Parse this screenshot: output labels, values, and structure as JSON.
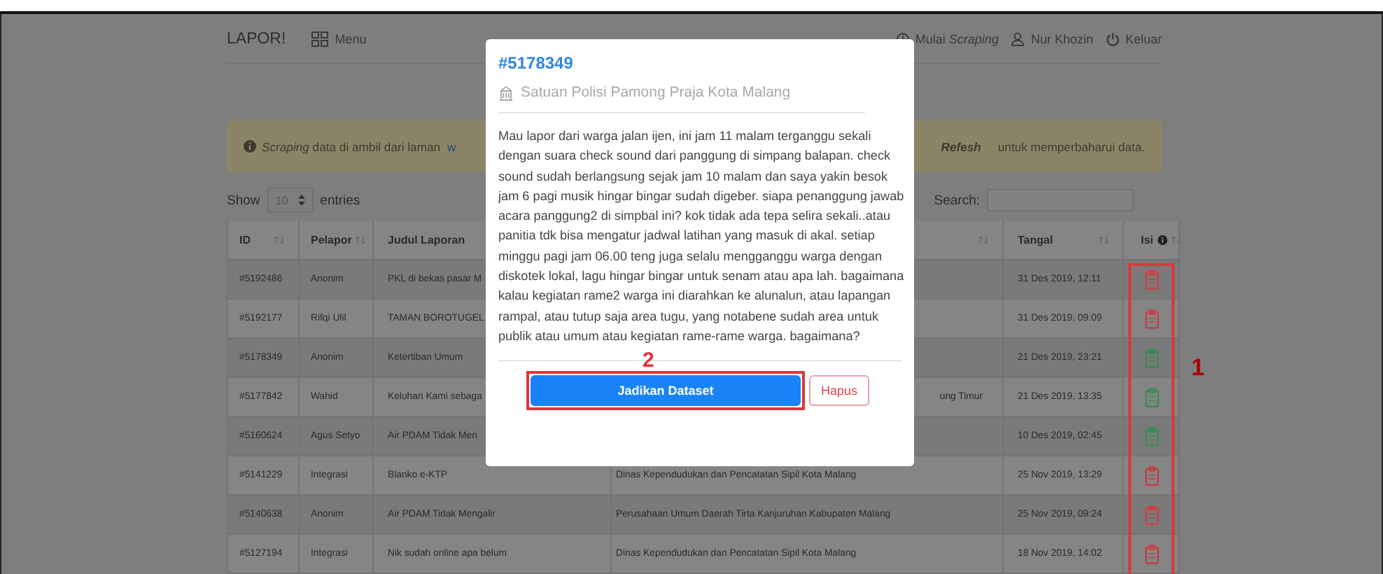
{
  "navbar": {
    "brand": "LAPOR!",
    "menu": "Menu",
    "actions": [
      {
        "label": "Mulai *Scraping*",
        "kind": "scrape"
      },
      {
        "label": "Nur Khozin",
        "kind": "user"
      },
      {
        "label": "Keluar",
        "kind": "logout"
      }
    ]
  },
  "alert": {
    "text": "*Scraping* data di ambil dari laman",
    "link": "w",
    "emphasis": "Refesh",
    "tail": "untuk memperbaharui data."
  },
  "table_controls": {
    "show_label": "Show",
    "page_size": "10",
    "entries_label": "entries",
    "search_label": "Search:"
  },
  "table": {
    "columns": [
      {
        "label": "ID"
      },
      {
        "label": "Pelapor"
      },
      {
        "label": "Judul Laporan"
      },
      {},
      {
        "label": "Tangal"
      },
      {
        "label": "Isi",
        "info": true
      }
    ],
    "rows": [
      {
        "id": "#5192486",
        "pelapor": "Anonim",
        "judul": "PKL di bekas pasar M",
        "tanggal": "31 Des 2019, 12:11",
        "color": "#c2464d"
      },
      {
        "id": "#5192177",
        "pelapor": "Rifqi Ulil",
        "judul": "TAMAN BOROTUGEL",
        "tanggal": "31 Des 2019, 09:09",
        "color": "#c2464d"
      },
      {
        "id": "#5178349",
        "pelapor": "Anonim",
        "judul": "Ketertiban Umum",
        "tanggal": "21 Des 2019, 23:21",
        "color": "#3d8a5d"
      },
      {
        "id": "#5177842",
        "pelapor": "Wahid",
        "judul": "Keluhan Kami sebaga",
        "terlapor": "ung Timur",
        "tanggal": "21 Des 2019, 13:35",
        "color": "#3d8a5d"
      },
      {
        "id": "#5160624",
        "pelapor": "Agus Setyo",
        "judul": "Air PDAM Tidak Men",
        "tanggal": "10 Des 2019, 02:45",
        "color": "#3d8a5d"
      },
      {
        "id": "#5141229",
        "pelapor": "Integrasi",
        "judul": "Blanko e-KTP",
        "terlapor": "Dinas Kependudukan dan Pencatatan Sipil Kota Malang",
        "tanggal": "25 Nov 2019, 13:29",
        "color": "#c2464d"
      },
      {
        "id": "#5140638",
        "pelapor": "Anonim",
        "judul": "Air PDAM Tidak Mengalir",
        "terlapor": "Perusahaan Umum Daerah Tirta Kanjuruhan Kabupaten Malang",
        "tanggal": "25 Nov 2019, 09:24",
        "color": "#c2464d"
      },
      {
        "id": "#5127194",
        "pelapor": "Integrasi",
        "judul": "Nik sudah online apa belum",
        "terlapor": "Dinas Kependudukan dan Pencatatan Sipil Kota Malang",
        "tanggal": "18 Nov 2019, 14:02",
        "color": "#c2464d"
      }
    ]
  },
  "modal": {
    "title": "#5178349",
    "agency": "Satuan Polisi Pamong Praja Kota Malang",
    "body": "Mau lapor dari warga jalan ijen, ini jam 11 malam terganggu sekali dengan suara check sound dari panggung di simpang balapan. check sound sudah berlangsung sejak jam 10 malam dan saya yakin besok jam 6 pagi musik hingar bingar sudah digeber. siapa penanggung jawab acara panggung2 di simpbal ini? kok tidak ada tepa selira sekali..atau panitia tdk bisa mengatur jadwal latihan yang masuk di akal. setiap minggu pagi jam 06.00 teng juga selalu mengganggu warga dengan diskotek lokal, lagu hingar bingar untuk senam atau apa lah. bagaimana kalau kegiatan rame2 warga ini diarahkan ke alunalun, atau lapangan rampal, atau tutup saja area tugu, yang notabene sudah area untuk publik atau umum atau kegiatan rame-rame warga. bagaimana?",
    "buttons": [
      {
        "label": "Jadikan Dataset",
        "kind": "primary"
      },
      {
        "label": "Hapus",
        "kind": "danger"
      }
    ]
  },
  "annotations": [
    {
      "label": "2"
    },
    {
      "label": "1"
    }
  ]
}
